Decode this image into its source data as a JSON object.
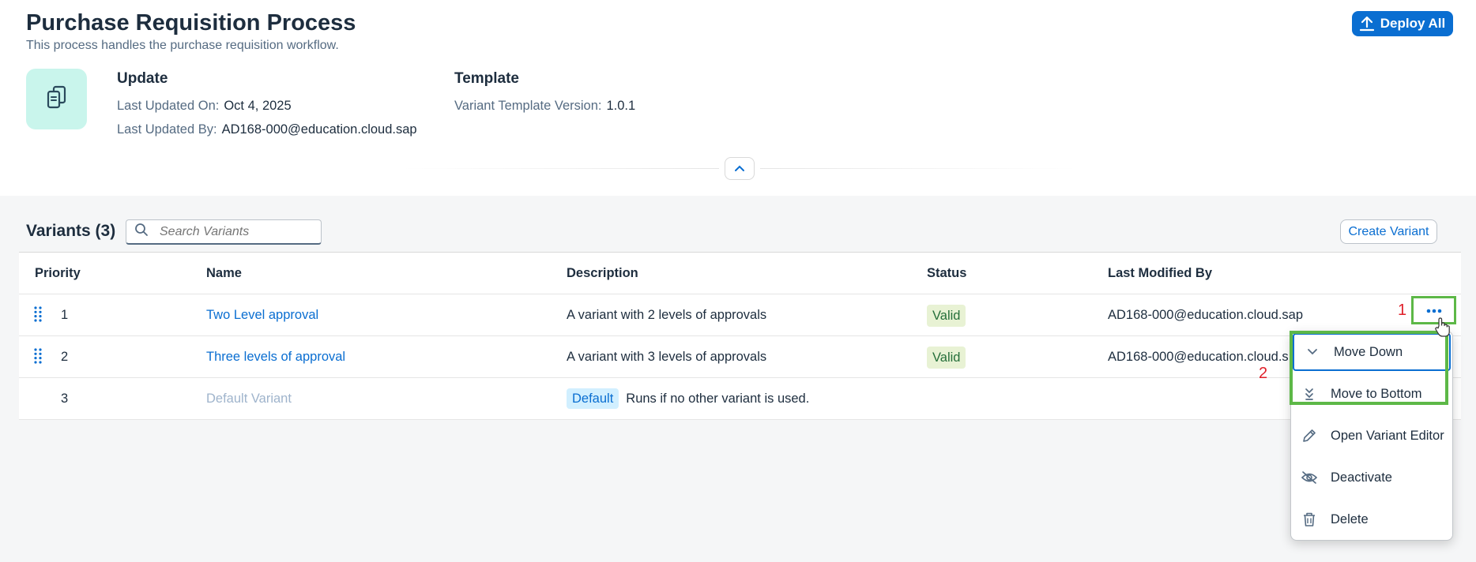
{
  "header": {
    "title": "Purchase Requisition Process",
    "subtitle": "This process handles the purchase requisition workflow.",
    "deploy_label": "Deploy All",
    "avatar_icon": "documents-icon",
    "update": {
      "heading": "Update",
      "last_updated_on_label": "Last Updated On:",
      "last_updated_on_value": "Oct 4, 2025",
      "last_updated_by_label": "Last Updated By:",
      "last_updated_by_value": "AD168-000@education.cloud.sap"
    },
    "template": {
      "heading": "Template",
      "version_label": "Variant Template Version:",
      "version_value": "1.0.1"
    }
  },
  "variants": {
    "title": "Variants (3)",
    "search_placeholder": "Search Variants",
    "create_label": "Create Variant",
    "columns": [
      "Priority",
      "Name",
      "Description",
      "Status",
      "Last Modified By"
    ],
    "rows": [
      {
        "priority": "1",
        "name": "Two Level approval",
        "description": "A variant with 2 levels of approvals",
        "status": "Valid",
        "modified_by": "AD168-000@education.cloud.sap"
      },
      {
        "priority": "2",
        "name": "Three levels of approval",
        "description": "A variant with 3 levels of approvals",
        "status": "Valid",
        "modified_by": "AD168-000@education.cloud.s"
      },
      {
        "priority": "3",
        "name": "Default Variant",
        "badge": "Default",
        "description": "Runs if no other variant is used.",
        "status": "",
        "modified_by": ""
      }
    ]
  },
  "annotations": {
    "one": "1",
    "two": "2"
  },
  "menu": {
    "items": [
      {
        "label": "Move Down",
        "icon": "chevron-down-icon"
      },
      {
        "label": "Move to Bottom",
        "icon": "double-chevron-down-icon"
      },
      {
        "label": "Open Variant Editor",
        "icon": "pencil-icon"
      },
      {
        "label": "Deactivate",
        "icon": "hide-icon"
      },
      {
        "label": "Delete",
        "icon": "trash-icon"
      }
    ]
  },
  "colors": {
    "accent": "#0a6ed1",
    "highlight": "#5db847",
    "annotation": "#e0202a",
    "valid_badge": "#e8f2d4",
    "avatar_bg": "#c9f5ec"
  }
}
